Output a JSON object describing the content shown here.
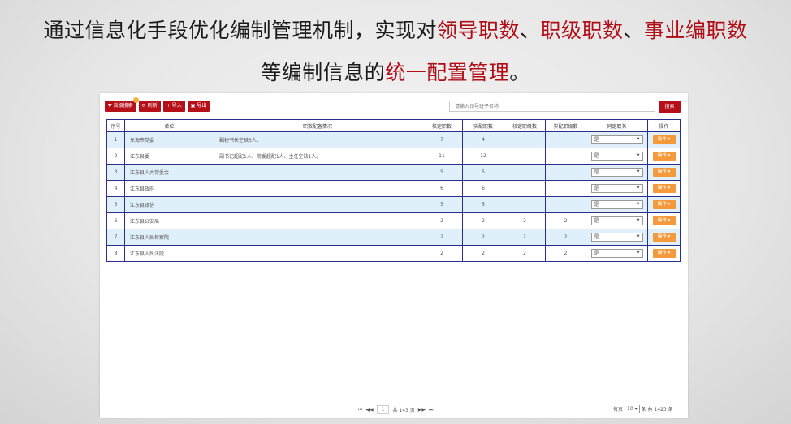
{
  "heading": {
    "line1_a": "通过信息化手段优化编制管理机制，实现对",
    "line1_h1": "领导职数",
    "line1_sep1": "、",
    "line1_h2": "职级职数",
    "line1_sep2": "、",
    "line1_h3": "事业编职数",
    "line2_a": "等编制信息的",
    "line2_h": "统一配置管理",
    "line2_end": "。"
  },
  "toolbar": {
    "advanced_search": "高级搜索",
    "refresh": "刷新",
    "import": "导入",
    "export": "导出"
  },
  "search": {
    "placeholder": "请输入领导班子名称",
    "button": "搜索"
  },
  "table": {
    "headers": [
      "序号",
      "单位",
      "职数配备情况",
      "核定职数",
      "实配职数",
      "核定职级数",
      "实配职级数",
      "同定职务",
      "操作"
    ],
    "rows": [
      {
        "no": "1",
        "unit": "东海市党委",
        "remark": "副秘书长空缺3人。",
        "a": "7",
        "b": "4",
        "c": "",
        "d": "",
        "duty": "是",
        "op": "操作 ▾"
      },
      {
        "no": "2",
        "unit": "江东县委",
        "remark": "副书记超配1人、常委超配1人、主任空缺1人。",
        "a": "11",
        "b": "12",
        "c": "",
        "d": "",
        "duty": "是",
        "op": "操作 ▾"
      },
      {
        "no": "3",
        "unit": "江东县人大常委会",
        "remark": "",
        "a": "5",
        "b": "5",
        "c": "",
        "d": "",
        "duty": "是",
        "op": "操作 ▾"
      },
      {
        "no": "4",
        "unit": "江东县政府",
        "remark": "",
        "a": "6",
        "b": "6",
        "c": "",
        "d": "",
        "duty": "是",
        "op": "操作 ▾"
      },
      {
        "no": "5",
        "unit": "江东县政协",
        "remark": "",
        "a": "5",
        "b": "5",
        "c": "",
        "d": "",
        "duty": "是",
        "op": "操作 ▾"
      },
      {
        "no": "6",
        "unit": "江东县公安局",
        "remark": "",
        "a": "2",
        "b": "2",
        "c": "2",
        "d": "2",
        "duty": "是",
        "op": "操作 ▾"
      },
      {
        "no": "7",
        "unit": "江东县人民检察院",
        "remark": "",
        "a": "2",
        "b": "2",
        "c": "2",
        "d": "2",
        "duty": "是",
        "op": "操作 ▾"
      },
      {
        "no": "8",
        "unit": "江东县人民法院",
        "remark": "",
        "a": "2",
        "b": "2",
        "c": "2",
        "d": "2",
        "duty": "是",
        "op": "操作 ▾"
      }
    ]
  },
  "pager": {
    "first": "⏮",
    "prev": "◀◀",
    "page": "1",
    "total_pages": "共 143 页",
    "next": "▶▶",
    "last": "⏭",
    "per_page_label": "每页",
    "per_page": "10",
    "total_label": "条 共 1423 条"
  },
  "colors": {
    "brand": "#b5101a",
    "highlight": "#b00d16",
    "row_alt": "#dff0fb",
    "grid_border": "#2a2e8c",
    "op_button": "#f49a3a"
  },
  "icons": {
    "advanced_search": "filter-icon",
    "refresh": "refresh-icon",
    "import": "plus-icon",
    "export": "file-icon"
  }
}
